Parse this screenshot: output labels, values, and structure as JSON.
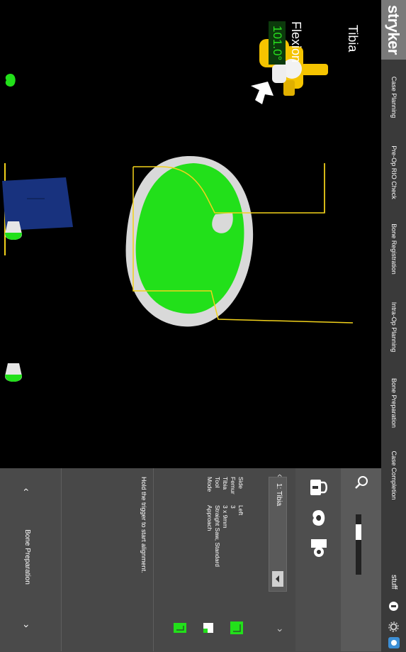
{
  "brand": {
    "logo": "stryker"
  },
  "nav": {
    "tabs": [
      {
        "label": "Case Planning"
      },
      {
        "label": "Pre-Op RIO Check"
      },
      {
        "label": "Bone Registration"
      },
      {
        "label": "Intra-Op Planning"
      },
      {
        "label": "Bone Preparation"
      },
      {
        "label": "Case Completion"
      }
    ]
  },
  "user": {
    "name": "stuff"
  },
  "viewport": {
    "bone_label": "Tibia",
    "flexion_label": "Flexion",
    "flexion_value": "101.0°"
  },
  "panel": {
    "info": [
      {
        "key": "Side",
        "value": "Left"
      },
      {
        "key": "Femur",
        "value": "3"
      },
      {
        "key": "Tibia",
        "value": "3 x 9mm"
      },
      {
        "key": "Tool",
        "value": "Straight Saw, Standard"
      },
      {
        "key": "Mode",
        "value": "Approach"
      }
    ],
    "selector_value": "1: Tibia",
    "instruction": "Hold the trigger to start alignment.",
    "footer_label": "Bone Preparation"
  },
  "colors": {
    "accent_green": "#22e01a",
    "implant_yellow": "#f2d21b",
    "robot_yellow": "#f5c400",
    "bone_white": "#d9d9d9",
    "blue_part": "#18327e"
  }
}
